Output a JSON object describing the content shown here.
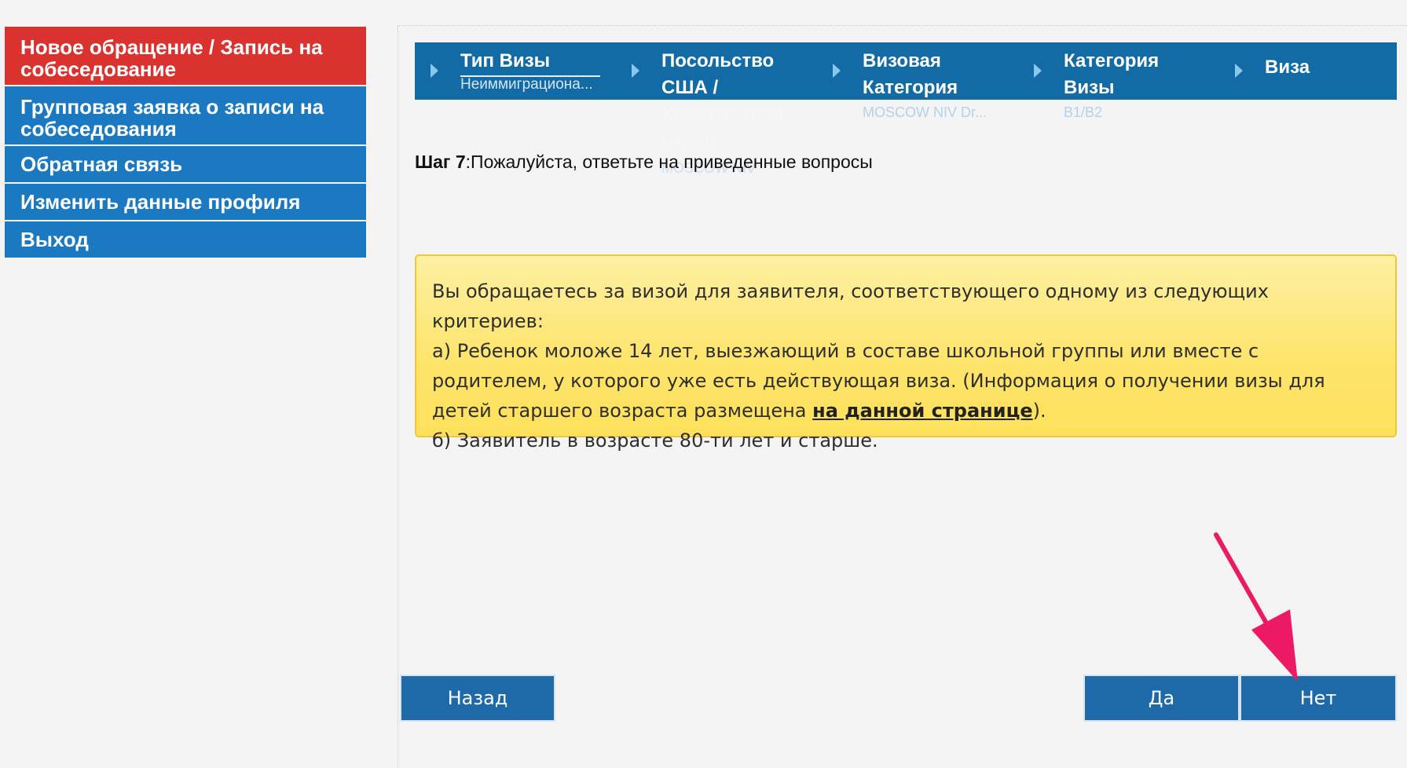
{
  "sidebar": {
    "items": [
      {
        "label": "Новое обращение / Запись на собеседование"
      },
      {
        "label": "Групповая заявка о записи на собеседования"
      },
      {
        "label": "Обратная связь"
      },
      {
        "label": "Изменить данные профиля"
      },
      {
        "label": "Выход"
      }
    ]
  },
  "steps": [
    {
      "title": "Тип Визы",
      "subtitle": "Неиммиграциона..."
    },
    {
      "title_line1": "Посольство",
      "title_line2": "США /",
      "overflow_line1": "Консульский",
      "overflow_line2": "отдел",
      "subtitle": "MOSCOW NIV"
    },
    {
      "title_line1": "Визовая",
      "title_line2": "Категория",
      "subtitle": "MOSCOW NIV Dr..."
    },
    {
      "title_line1": "Категория",
      "title_line2": "Визы",
      "subtitle": "B1/B2"
    },
    {
      "title": "Виза"
    }
  ],
  "step_heading": {
    "label": "Шаг 7",
    "text": ":Пожалуйста, ответьте на приведенные вопросы"
  },
  "notice": {
    "line1": "Вы обращаетесь за визой для заявителя, соответствующего одному из следующих критериев:",
    "line2_pre": "а) Ребенок моложе 14 лет, выезжающий в составе школьной группы или вместе с родителем, у которого уже есть действующая виза. (Информация о получении визы для детей старшего возраста размещена ",
    "line2_link": "на данной странице",
    "line2_post": ").",
    "line3": "б) Заявитель в возрасте 80-ти лет и старше."
  },
  "buttons": {
    "back": "Назад",
    "yes": "Да",
    "no": "Нет"
  },
  "colors": {
    "sidebar_active": "#d9322f",
    "sidebar_item": "#1a79c1",
    "steps_bar": "#136ba5",
    "button": "#1e6aa9",
    "notice_bg": "#fde46a",
    "annotation_arrow": "#ec1a63"
  }
}
